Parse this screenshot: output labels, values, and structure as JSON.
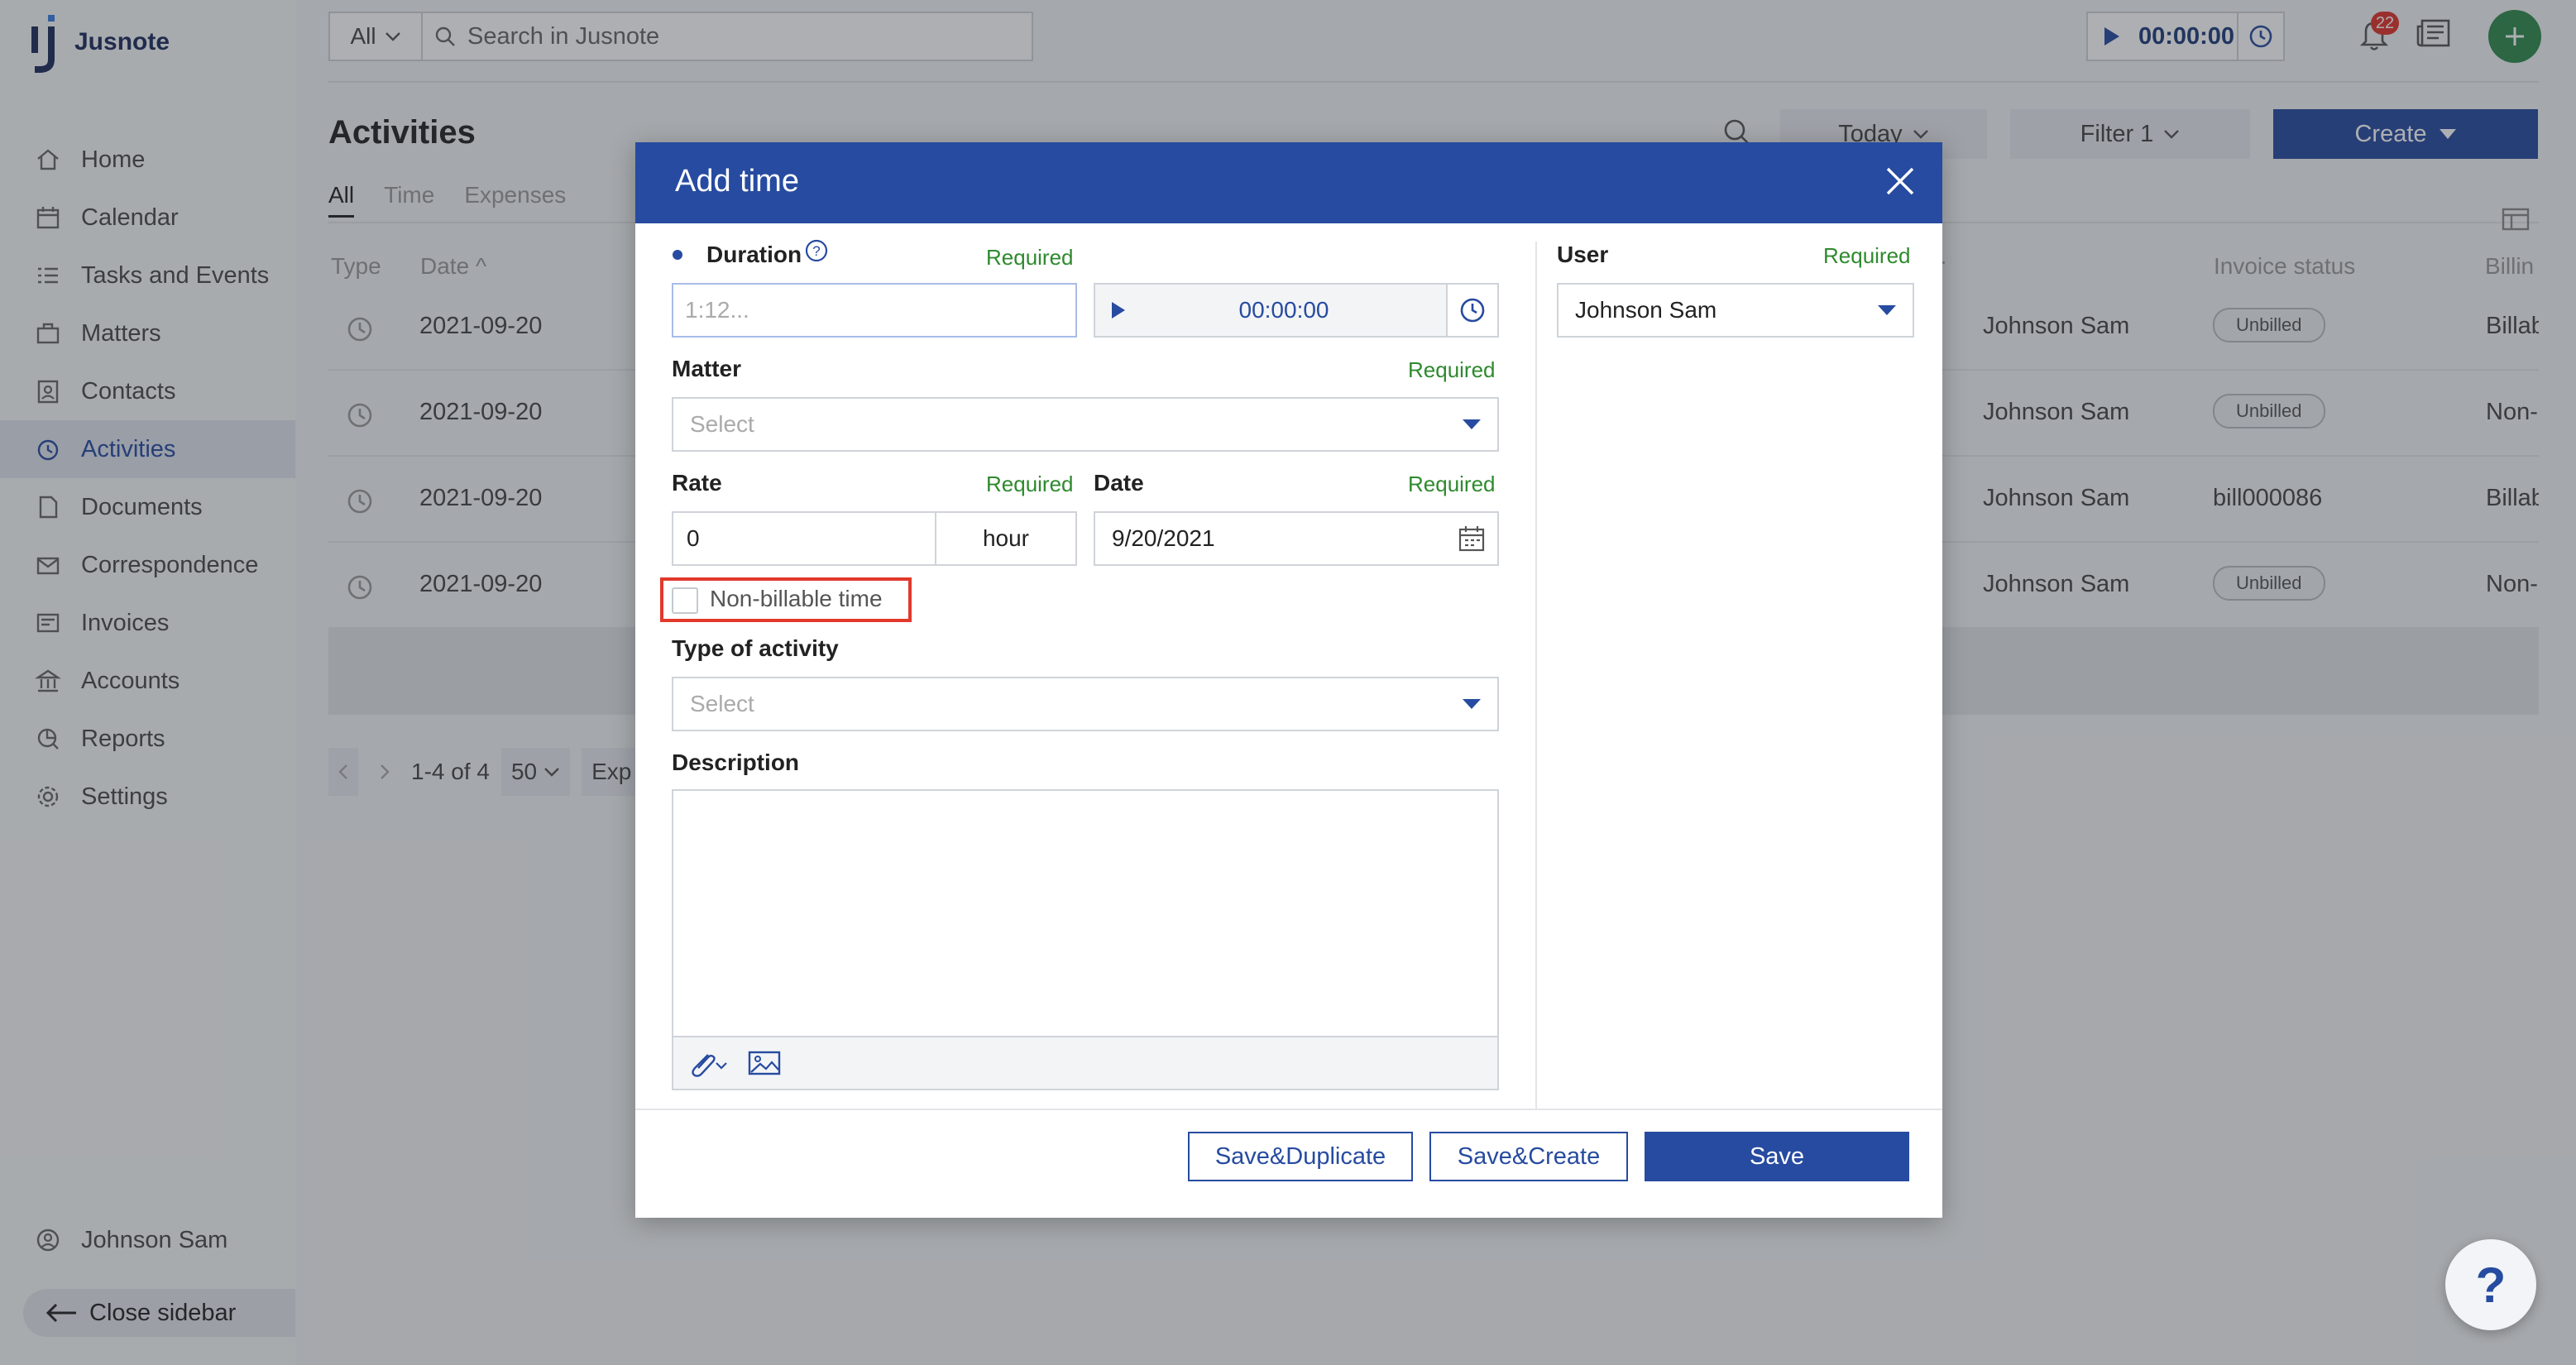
{
  "app": {
    "name": "Jusnote"
  },
  "sidebar": {
    "items": [
      {
        "label": "Home",
        "icon": "home-icon"
      },
      {
        "label": "Calendar",
        "icon": "calendar-icon"
      },
      {
        "label": "Tasks and Events",
        "icon": "tasks-icon"
      },
      {
        "label": "Matters",
        "icon": "briefcase-icon"
      },
      {
        "label": "Contacts",
        "icon": "contacts-icon"
      },
      {
        "label": "Activities",
        "icon": "activities-icon",
        "active": true
      },
      {
        "label": "Documents",
        "icon": "documents-icon"
      },
      {
        "label": "Correspondence",
        "icon": "correspondence-icon"
      },
      {
        "label": "Invoices",
        "icon": "invoices-icon"
      },
      {
        "label": "Accounts",
        "icon": "accounts-icon"
      },
      {
        "label": "Reports",
        "icon": "reports-icon"
      },
      {
        "label": "Settings",
        "icon": "gear-icon"
      }
    ],
    "user": "Johnson Sam",
    "close_label": "Close sidebar"
  },
  "topbar": {
    "scope": "All",
    "search_placeholder": "Search in Jusnote",
    "timer": "00:00:00",
    "notifications": "22"
  },
  "page": {
    "title": "Activities",
    "tabs": [
      "All",
      "Time",
      "Expenses"
    ],
    "filter_today": "Today",
    "filter_label": "Filter 1",
    "create_label": "Create",
    "columns": {
      "type": "Type",
      "date": "Date",
      "user_partial": "r",
      "invoice_status": "Invoice status",
      "billing": "Billin"
    },
    "rows": [
      {
        "date": "2021-09-20",
        "user": "Johnson Sam",
        "status": "Unbilled",
        "billing": "Billab"
      },
      {
        "date": "2021-09-20",
        "user": "Johnson Sam",
        "status": "Unbilled",
        "billing": "Non-"
      },
      {
        "date": "2021-09-20",
        "user": "Johnson Sam",
        "status": "bill000086",
        "billing": "Billab"
      },
      {
        "date": "2021-09-20",
        "user": "Johnson Sam",
        "status": "Unbilled",
        "billing": "Non-"
      }
    ],
    "pager": {
      "range": "1-4 of 4",
      "per_page": "50",
      "export": "Exp"
    }
  },
  "modal": {
    "title": "Add time",
    "duration_label": "Duration",
    "duration_placeholder": "1:12...",
    "required": "Required",
    "timer": "00:00:00",
    "matter_label": "Matter",
    "select_placeholder": "Select",
    "rate_label": "Rate",
    "rate_value": "0",
    "rate_unit": "hour",
    "date_label": "Date",
    "date_value": "9/20/2021",
    "nonbillable_label": "Non-billable time",
    "type_label": "Type of activity",
    "description_label": "Description",
    "user_label": "User",
    "user_value": "Johnson Sam",
    "buttons": {
      "save_duplicate": "Save&Duplicate",
      "save_create": "Save&Create",
      "save": "Save"
    }
  },
  "help": "?",
  "colors": {
    "primary": "#274ba0",
    "required": "#2e8a2e",
    "highlight": "#e1392b",
    "green_button": "#2f8a4c"
  }
}
